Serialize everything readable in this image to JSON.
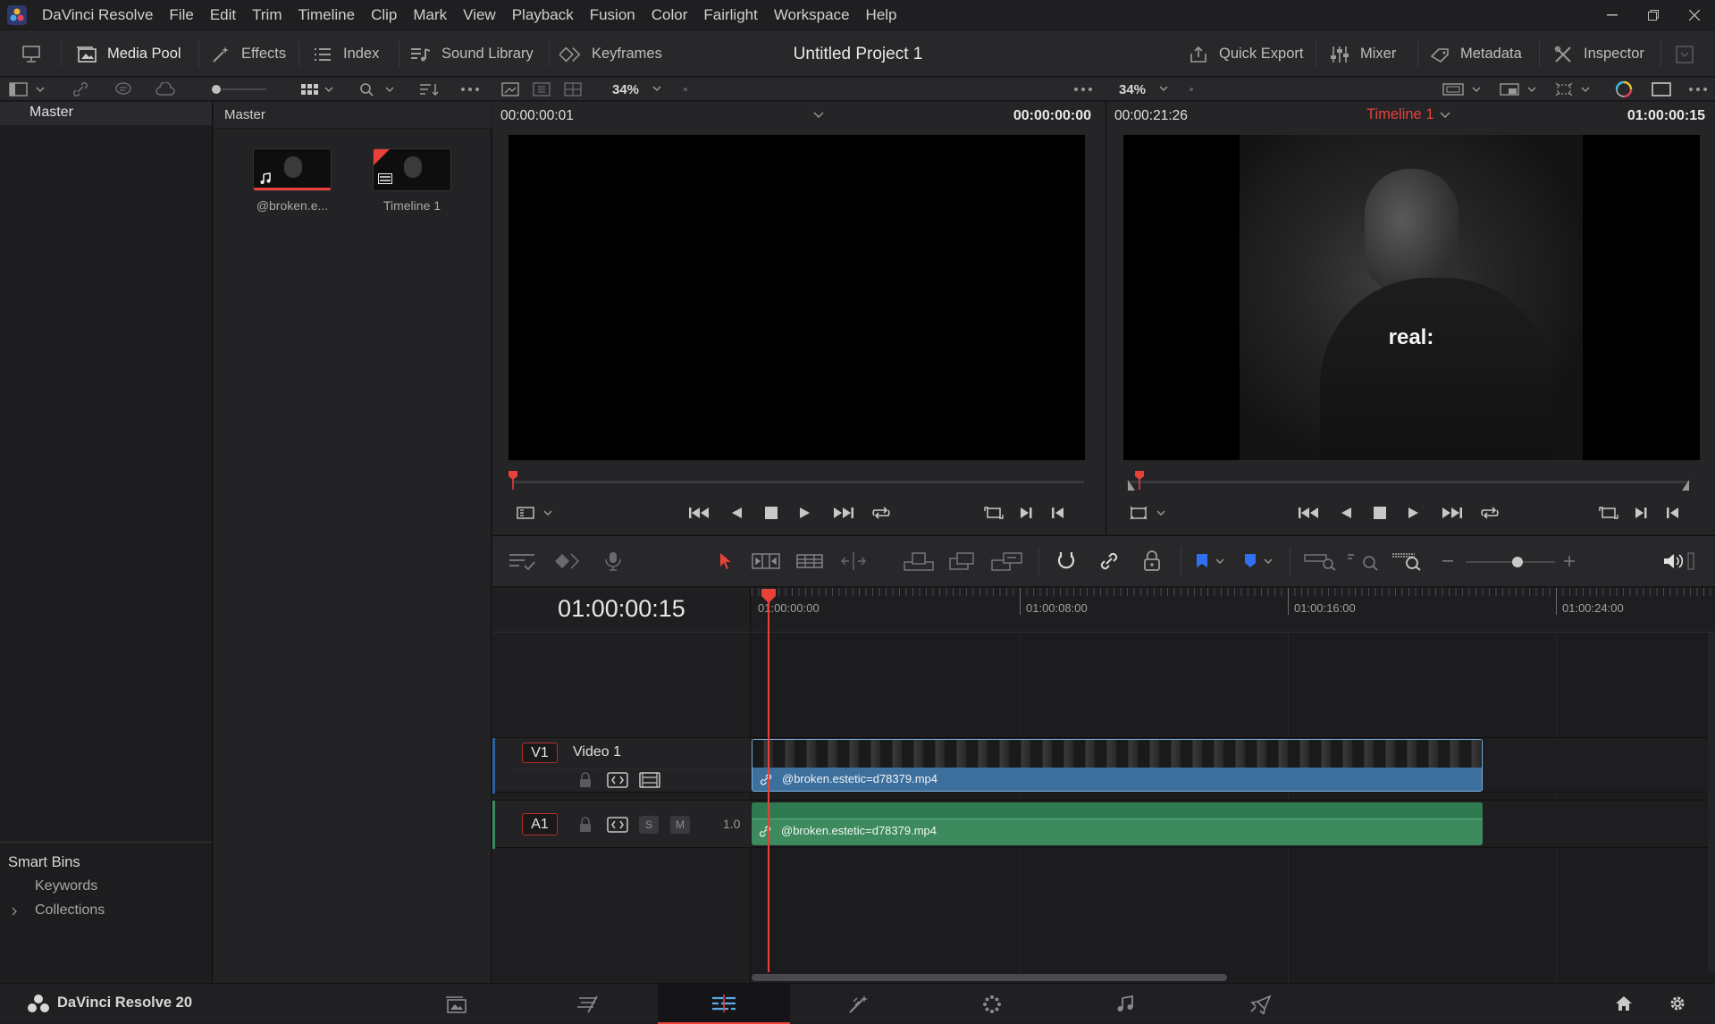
{
  "menu": {
    "app_name": "DaVinci Resolve",
    "items": [
      "File",
      "Edit",
      "Trim",
      "Timeline",
      "Clip",
      "Mark",
      "View",
      "Playback",
      "Fusion",
      "Color",
      "Fairlight",
      "Workspace",
      "Help"
    ]
  },
  "toolbar": {
    "media_pool": "Media Pool",
    "effects": "Effects",
    "index": "Index",
    "sound_library": "Sound Library",
    "keyframes": "Keyframes",
    "project_title": "Untitled Project 1",
    "quick_export": "Quick Export",
    "mixer": "Mixer",
    "metadata": "Metadata",
    "inspector": "Inspector"
  },
  "subbar": {
    "source_zoom": "34%",
    "timeline_zoom": "34%"
  },
  "bins": {
    "master": "Master",
    "smart_bins_title": "Smart Bins",
    "smart_bins": [
      "Keywords",
      "Collections"
    ]
  },
  "media_pool": {
    "header": "Master",
    "clips": [
      {
        "name": "@broken.e..."
      },
      {
        "name": "Timeline 1"
      }
    ]
  },
  "source_viewer": {
    "timecode_left": "00:00:00:01",
    "timecode_right": "00:00:00:00"
  },
  "timeline_viewer": {
    "timecode_left": "00:00:21:26",
    "timeline_name": "Timeline 1",
    "timecode_right": "01:00:00:15",
    "subtitle": "real:"
  },
  "timeline": {
    "current_timecode": "01:00:00:15",
    "ruler": [
      "01:00:00:00",
      "01:00:08:00",
      "01:00:16:00",
      "01:00:24:00"
    ],
    "video_track": {
      "tag": "V1",
      "name": "Video 1",
      "clip": "@broken.estetic=d78379.mp4"
    },
    "audio_track": {
      "tag": "A1",
      "level": "1.0",
      "solo": "S",
      "mute": "M",
      "clip": "@broken.estetic=d78379.mp4"
    }
  },
  "footer": {
    "app_version": "DaVinci Resolve 20"
  },
  "colors": {
    "accent_red": "#e8413a",
    "video_clip": "#3d6f9c",
    "audio_clip": "#3d8a5e"
  }
}
